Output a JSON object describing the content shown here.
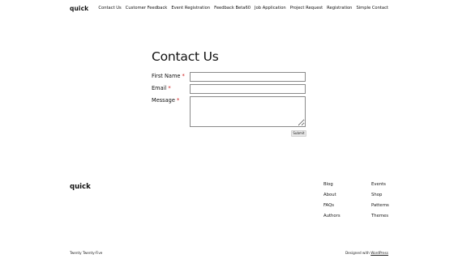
{
  "header": {
    "site_title": "quick",
    "nav": [
      "Contact Us",
      "Customer Feedback",
      "Event Registration",
      "Feedback Beta60",
      "Job Application",
      "Project Request",
      "Registration",
      "Simple Contact"
    ]
  },
  "form": {
    "title": "Contact Us",
    "fields": [
      {
        "label": "First Name",
        "required": "*",
        "value": ""
      },
      {
        "label": "Email",
        "required": "*",
        "value": ""
      },
      {
        "label": "Message",
        "required": "*",
        "value": ""
      }
    ],
    "submit_label": "Submit"
  },
  "footer": {
    "site_title": "quick",
    "col1": [
      "Blog",
      "About",
      "FAQs",
      "Authors"
    ],
    "col2": [
      "Events",
      "Shop",
      "Patterns",
      "Themes"
    ],
    "credit_left": "Twenty Twenty-Five",
    "credit_right_prefix": "Designed with ",
    "credit_right_link": "WordPress"
  },
  "colors": {
    "required": "#cc1818",
    "border": "#8a8a8a",
    "text": "#111111"
  }
}
